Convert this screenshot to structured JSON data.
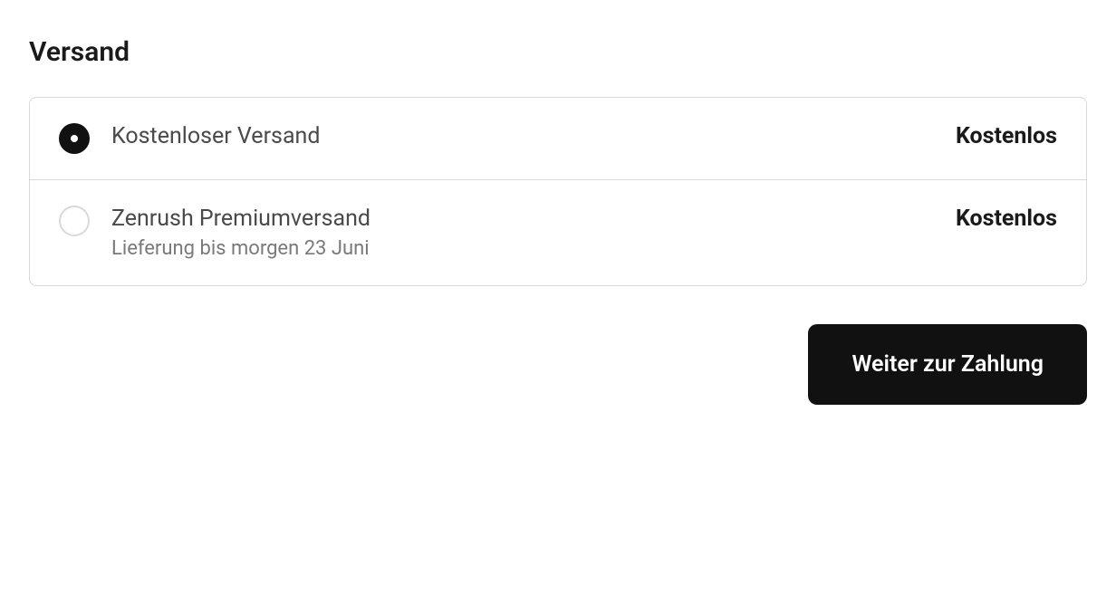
{
  "section": {
    "title": "Versand"
  },
  "shipping": {
    "options": [
      {
        "label": "Kostenloser Versand",
        "subtext": "",
        "price": "Kostenlos",
        "selected": true
      },
      {
        "label": "Zenrush Premiumversand",
        "subtext": "Lieferung bis morgen 23 Juni",
        "price": "Kostenlos",
        "selected": false
      }
    ]
  },
  "actions": {
    "continue_label": "Weiter zur Zahlung"
  }
}
